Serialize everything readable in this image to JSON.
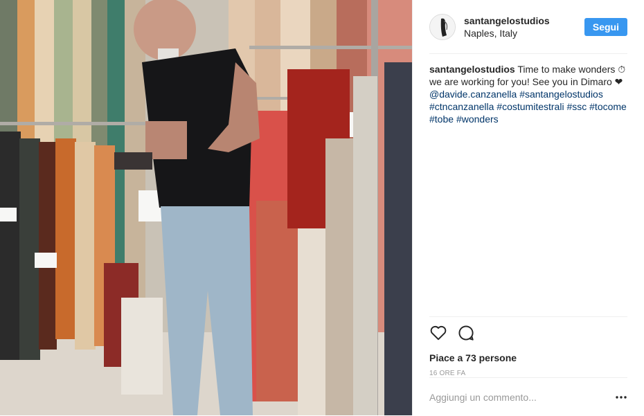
{
  "post": {
    "user": {
      "username": "santangelostudios",
      "location": "Naples, Italy"
    },
    "follow_label": "Segui",
    "caption": {
      "username": "santangelostudios",
      "text": " Time to make wonders ⏱ we are working for you! See you in Dimaro ❤ ",
      "tags": [
        "@davide.canzanella",
        "#santangelostudios",
        "#ctncanzanella",
        "#costumitestrali",
        "#ssc",
        "#tocome",
        "#tobe",
        "#wonders"
      ]
    },
    "likes_label": "Piace a 73 persone",
    "time_label": "16 ORE FA",
    "comment_placeholder": "Aggiungi un commento...",
    "icons": {
      "like": "heart-icon",
      "comment": "comment-bubble-icon",
      "more": "more-options-icon"
    },
    "colors": {
      "accent": "#3897f0",
      "hashtag": "#003569",
      "muted": "#999999",
      "border": "#efefef"
    }
  }
}
